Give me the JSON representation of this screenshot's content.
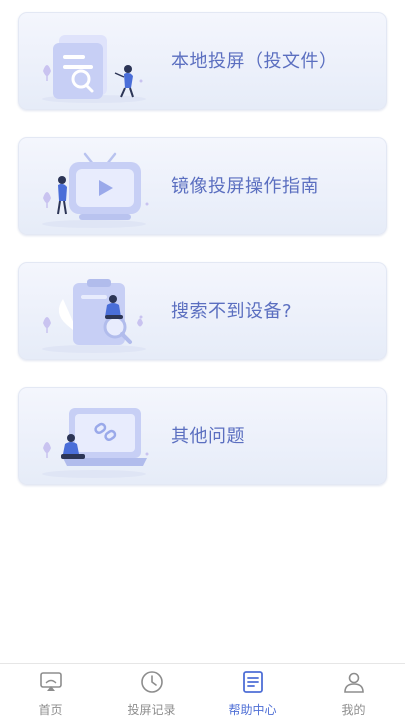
{
  "menu": {
    "items": [
      {
        "label": "本地投屏（投文件）",
        "icon": "file-search-illustration"
      },
      {
        "label": "镜像投屏操作指南",
        "icon": "tv-play-illustration"
      },
      {
        "label": "搜索不到设备?",
        "icon": "clipboard-search-illustration"
      },
      {
        "label": "其他问题",
        "icon": "laptop-link-illustration"
      }
    ]
  },
  "tabbar": {
    "active": "帮助中心",
    "active_color": "#4f6fd6",
    "inactive_color": "#8d8d8d",
    "tabs": [
      {
        "label": "首页",
        "icon": "cast-screen-icon"
      },
      {
        "label": "投屏记录",
        "icon": "clock-icon"
      },
      {
        "label": "帮助中心",
        "icon": "document-icon"
      },
      {
        "label": "我的",
        "icon": "person-icon"
      }
    ]
  },
  "colors": {
    "card_gradient_top": "#f4f6fd",
    "card_gradient_bottom": "#e6ecf8",
    "label_color": "#5b6fc0"
  }
}
